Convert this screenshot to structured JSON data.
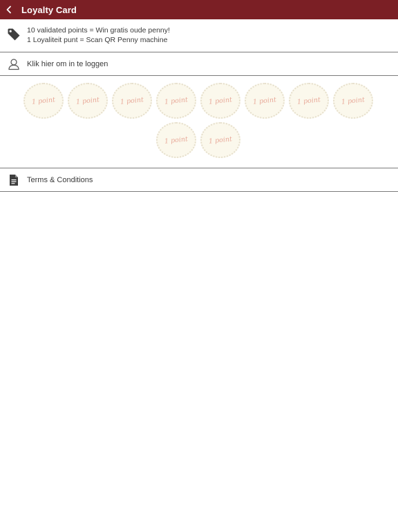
{
  "header": {
    "title": "Loyalty Card",
    "back_icon": "chevron-left-icon",
    "background_color": "#7b1f25"
  },
  "info": {
    "icon": "tag-icon",
    "line1": "10 validated points = Win gratis oude penny!",
    "line2": "1 Loyaliteit punt = Scan QR Penny machine"
  },
  "login": {
    "icon": "user-icon",
    "label": "Klik hier om in te loggen"
  },
  "stamps": {
    "total": 10,
    "label": "1 point",
    "items": [
      "1 point",
      "1 point",
      "1 point",
      "1 point",
      "1 point",
      "1 point",
      "1 point",
      "1 point",
      "1 point",
      "1 point"
    ]
  },
  "terms": {
    "icon": "document-icon",
    "label": "Terms & Conditions"
  }
}
